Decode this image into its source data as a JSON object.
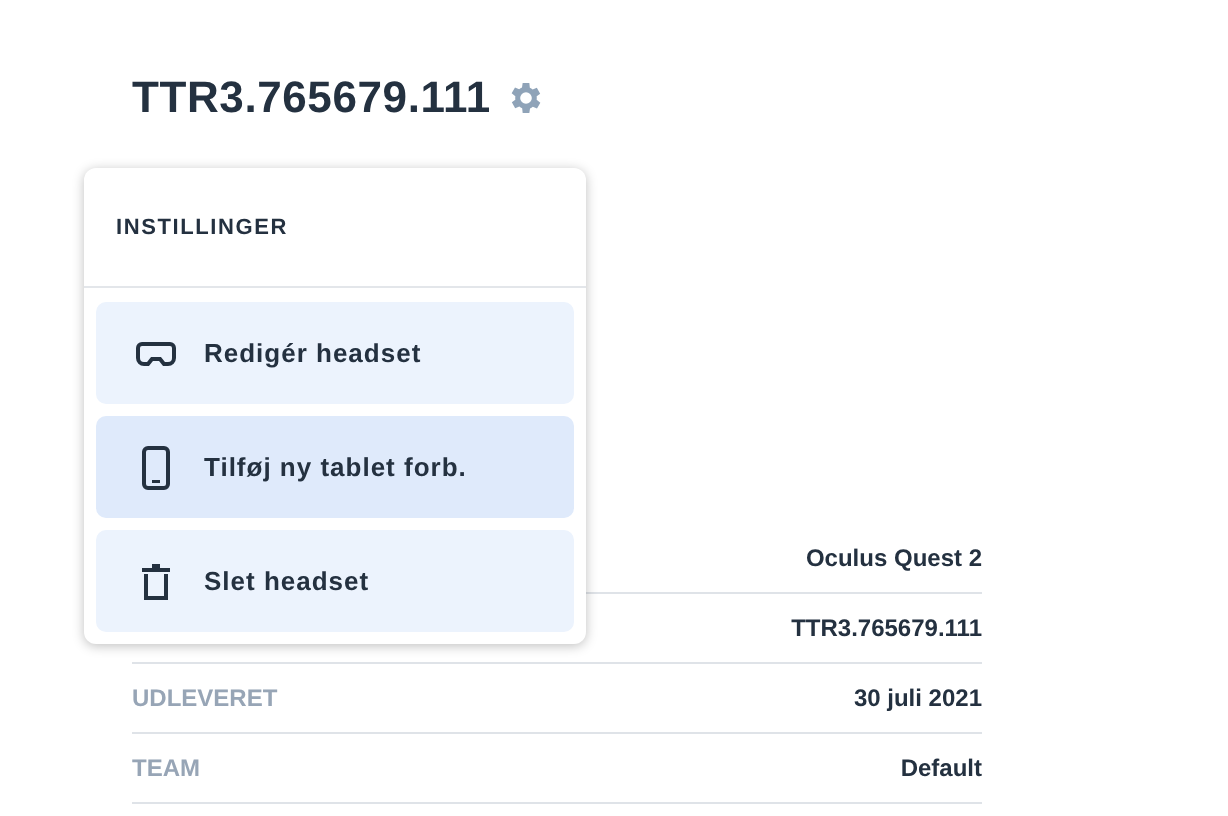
{
  "title": "TTR3.765679.111",
  "menu": {
    "heading": "INSTILLINGER",
    "items": [
      {
        "kind": "headset",
        "label": "Redigér headset",
        "selected": false
      },
      {
        "kind": "tablet",
        "label": "Tilføj ny tablet forb.",
        "selected": true
      },
      {
        "kind": "trash",
        "label": "Slet headset",
        "selected": false
      }
    ]
  },
  "details": [
    {
      "value": "Oculus Quest 2"
    },
    {
      "value": "TTR3.765679.111"
    },
    {
      "label": "UDLEVERET",
      "value": "30 juli 2021"
    },
    {
      "label": "TEAM",
      "value": "Default"
    }
  ]
}
